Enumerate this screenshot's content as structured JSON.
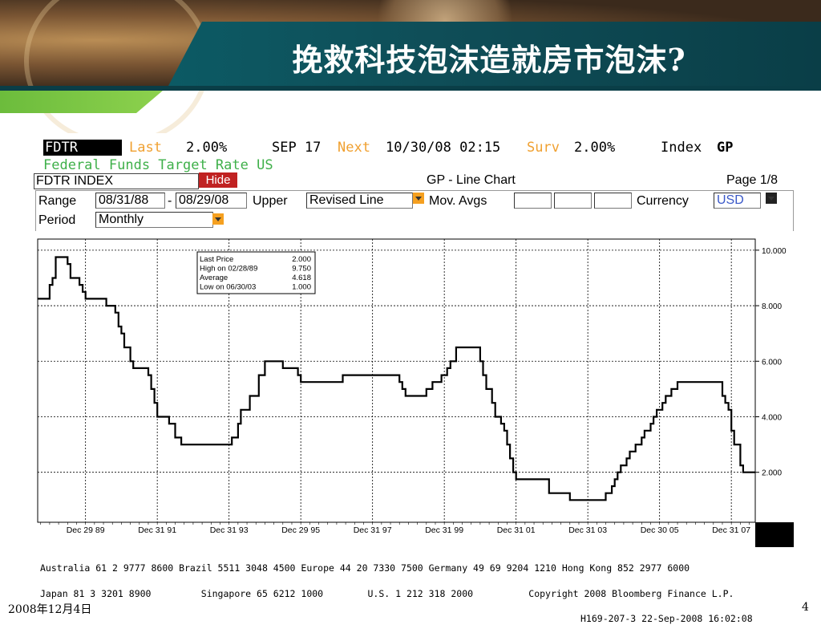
{
  "slide": {
    "title": "挽救科技泡沫造就房市泡沫?",
    "date": "2008年12月4日",
    "page_number": "4"
  },
  "terminal": {
    "ticker": "FDTR",
    "last_label": "Last",
    "last_value": "2.00%",
    "date": "SEP 17",
    "next_label": "Next",
    "next_value": "10/30/08 02:15",
    "surv_label": "Surv",
    "surv_value": "2.00%",
    "index_label": "Index",
    "index_value": "GP",
    "description": "Federal Funds Target Rate US",
    "index_field": "FDTR INDEX",
    "hide_label": "Hide",
    "chart_title": "GP - Line Chart",
    "page": "Page 1/8",
    "range_label": "Range",
    "range_start": "08/31/88",
    "range_dash": "-",
    "range_end": "08/29/08",
    "upper_label": "Upper",
    "upper_value": "Revised Line",
    "mov_avgs_label": "Mov. Avgs",
    "currency_label": "Currency",
    "currency_value": "USD",
    "period_label": "Period",
    "period_value": "Monthly",
    "footer_line1": "Australia 61 2 9777 8600 Brazil 5511 3048 4500 Europe 44 20 7330 7500 Germany 49 69 9204 1210 Hong Kong 852 2977 6000",
    "footer_line2": "Japan 81 3 3201 8900         Singapore 65 6212 1000        U.S. 1 212 318 2000          Copyright 2008 Bloomberg Finance L.P.",
    "footer_line3": "H169-207-3 22-Sep-2008 16:02:08"
  },
  "legend_box": {
    "rows": [
      {
        "label": "Last Price",
        "value": "2.000"
      },
      {
        "label": "High on  02/28/89",
        "value": "9.750"
      },
      {
        "label": "Average",
        "value": "4.618"
      },
      {
        "label": "Low on  06/30/03",
        "value": "1.000"
      }
    ]
  },
  "colors": {
    "title_band": "#0c5a64",
    "accent_green": "#6cbc3c",
    "hide_button": "#c02222",
    "dropdown": "#f5a020",
    "series_line": "#000000",
    "ticker_orange": "#f0a030",
    "description_green": "#3fb04a"
  },
  "chart_data": {
    "type": "line",
    "title": "GP - Line Chart",
    "series_name": "FDTR INDEX",
    "x_tick_labels": [
      "Dec 29 89",
      "Dec 31 91",
      "Dec 31 93",
      "Dec 29 95",
      "Dec 31 97",
      "Dec 31 99",
      "Dec 31 01",
      "Dec 31 03",
      "Dec 30 05",
      "Dec 31 07"
    ],
    "y_tick_labels": [
      "10.000",
      "8.000",
      "6.000",
      "4.000",
      "2.000"
    ],
    "ylim": [
      0.2,
      10.4
    ],
    "xlim": [
      1988.6667,
      2008.6667
    ],
    "grid": true,
    "y_axis_side": "right",
    "points": [
      [
        1988.67,
        8.25
      ],
      [
        1988.92,
        8.25
      ],
      [
        1989.0,
        8.75
      ],
      [
        1989.08,
        9.0
      ],
      [
        1989.17,
        9.75
      ],
      [
        1989.42,
        9.75
      ],
      [
        1989.5,
        9.5
      ],
      [
        1989.58,
        9.0
      ],
      [
        1989.83,
        8.75
      ],
      [
        1989.92,
        8.5
      ],
      [
        1990.0,
        8.25
      ],
      [
        1990.5,
        8.25
      ],
      [
        1990.58,
        8.0
      ],
      [
        1990.83,
        7.75
      ],
      [
        1990.92,
        7.25
      ],
      [
        1991.0,
        7.0
      ],
      [
        1991.08,
        6.5
      ],
      [
        1991.25,
        6.0
      ],
      [
        1991.33,
        5.75
      ],
      [
        1991.75,
        5.5
      ],
      [
        1991.83,
        5.0
      ],
      [
        1991.92,
        4.5
      ],
      [
        1992.0,
        4.0
      ],
      [
        1992.25,
        4.0
      ],
      [
        1992.33,
        3.75
      ],
      [
        1992.5,
        3.25
      ],
      [
        1992.67,
        3.0
      ],
      [
        1994.0,
        3.0
      ],
      [
        1994.08,
        3.25
      ],
      [
        1994.25,
        3.75
      ],
      [
        1994.33,
        4.25
      ],
      [
        1994.58,
        4.75
      ],
      [
        1994.83,
        5.5
      ],
      [
        1995.0,
        6.0
      ],
      [
        1995.5,
        5.75
      ],
      [
        1995.92,
        5.5
      ],
      [
        1996.0,
        5.25
      ],
      [
        1996.83,
        5.25
      ],
      [
        1997.17,
        5.5
      ],
      [
        1998.67,
        5.5
      ],
      [
        1998.75,
        5.25
      ],
      [
        1998.83,
        5.0
      ],
      [
        1998.92,
        4.75
      ],
      [
        1999.42,
        4.75
      ],
      [
        1999.5,
        5.0
      ],
      [
        1999.67,
        5.25
      ],
      [
        1999.92,
        5.5
      ],
      [
        2000.08,
        5.75
      ],
      [
        2000.17,
        6.0
      ],
      [
        2000.33,
        6.5
      ],
      [
        2000.92,
        6.5
      ],
      [
        2001.0,
        6.0
      ],
      [
        2001.08,
        5.5
      ],
      [
        2001.17,
        5.0
      ],
      [
        2001.33,
        4.5
      ],
      [
        2001.42,
        4.0
      ],
      [
        2001.58,
        3.75
      ],
      [
        2001.67,
        3.5
      ],
      [
        2001.75,
        3.0
      ],
      [
        2001.83,
        2.5
      ],
      [
        2001.92,
        2.0
      ],
      [
        2002.0,
        1.75
      ],
      [
        2002.83,
        1.75
      ],
      [
        2002.92,
        1.25
      ],
      [
        2003.42,
        1.25
      ],
      [
        2003.5,
        1.0
      ],
      [
        2004.42,
        1.0
      ],
      [
        2004.5,
        1.25
      ],
      [
        2004.67,
        1.5
      ],
      [
        2004.75,
        1.75
      ],
      [
        2004.83,
        2.0
      ],
      [
        2004.92,
        2.25
      ],
      [
        2005.08,
        2.5
      ],
      [
        2005.17,
        2.75
      ],
      [
        2005.33,
        3.0
      ],
      [
        2005.5,
        3.25
      ],
      [
        2005.58,
        3.5
      ],
      [
        2005.75,
        3.75
      ],
      [
        2005.83,
        4.0
      ],
      [
        2005.92,
        4.25
      ],
      [
        2006.08,
        4.5
      ],
      [
        2006.17,
        4.75
      ],
      [
        2006.33,
        5.0
      ],
      [
        2006.5,
        5.25
      ],
      [
        2007.67,
        5.25
      ],
      [
        2007.75,
        4.75
      ],
      [
        2007.83,
        4.5
      ],
      [
        2007.92,
        4.25
      ],
      [
        2008.0,
        3.5
      ],
      [
        2008.08,
        3.0
      ],
      [
        2008.25,
        2.25
      ],
      [
        2008.33,
        2.0
      ],
      [
        2008.67,
        2.0
      ]
    ]
  }
}
